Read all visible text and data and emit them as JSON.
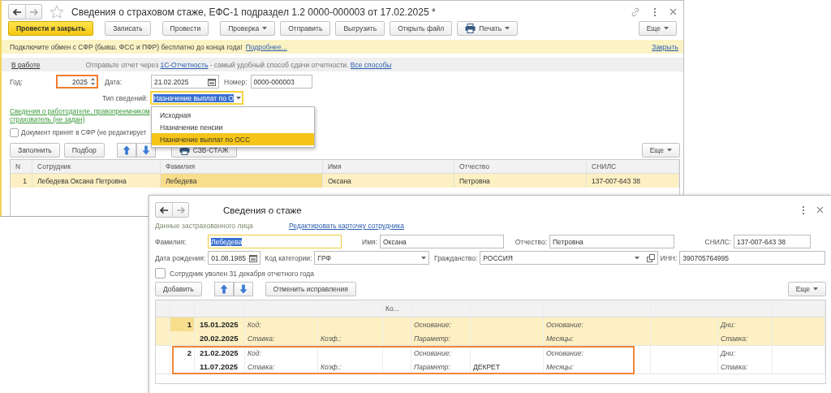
{
  "main_window": {
    "title": "Сведения о страховом стаже, ЕФС-1 подраздел 1.2 0000-000003 от 17.02.2025 *",
    "toolbar": [
      {
        "label": "Провести и закрыть",
        "kind": "primary"
      },
      {
        "label": "Записать",
        "kind": "plain"
      },
      {
        "label": "Провести",
        "kind": "plain"
      },
      {
        "label": "Проверка",
        "kind": "menu"
      },
      {
        "label": "Отправить",
        "kind": "plain"
      },
      {
        "label": "Выгрузить",
        "kind": "plain"
      },
      {
        "label": "Открыть файл",
        "kind": "plain"
      },
      {
        "label": "Печать",
        "kind": "print"
      }
    ],
    "more_button": "Еще",
    "notice": {
      "text": "Подключите обмен с СФР (бывш. ФСС и ПФР) бесплатно до конца года!",
      "link": "Подробнее...",
      "close": "Закрыть"
    },
    "status_bar": {
      "status": "В работе",
      "text_before": "Отправьте отчет через",
      "link": "1С-Отчетность",
      "text_after": "- самый удобный способ сдачи отчетности.",
      "link_2": "Все способы"
    },
    "year": {
      "label": "Год:",
      "value": "2025",
      "highlighted": true
    },
    "date": {
      "label": "Дата:",
      "value": "21.02.2025"
    },
    "number": {
      "label": "Номер:",
      "value": "0000-000003"
    },
    "info_type": {
      "label": "Тип сведений:",
      "value": "Назначение выплат по О",
      "expanded": true
    },
    "info_type_options": [
      {
        "label": "Исходная",
        "selected": false
      },
      {
        "label": "Назначение пенсии",
        "selected": false
      },
      {
        "label": "Назначение выплат по ОСС",
        "selected": true
      }
    ],
    "employer_link": [
      "Сведения о работодателе, правопреемником",
      "страхователь (не задан)"
    ],
    "accepted_checkbox": {
      "label": "Документ принят в СФР (не редактирует",
      "checked": false
    },
    "table_buttons": [
      "Заполнить",
      "Подбор"
    ],
    "report_button": "СЗВ-СТАЖ",
    "table_more": "Еще",
    "table": {
      "columns": [
        "N",
        "Сотрудник",
        "Фамилия",
        "Имя",
        "Отчество",
        "СНИЛС"
      ],
      "rows": [
        {
          "selected": true,
          "cells": [
            "1",
            "Лебедева Оксана Петровна",
            "Лебедева",
            "Оксана",
            "Петровна",
            "137-007-643 38"
          ]
        }
      ]
    }
  },
  "record_window": {
    "title": "Сведения о стаже",
    "section_label": "Данные застрахованного лица",
    "edit_link": "Редактировать карточку сотрудника",
    "fields_row_1": [
      {
        "label": "Фамилия:",
        "value": "Лебедева",
        "kind": "text",
        "focused": true
      },
      {
        "label": "Имя:",
        "value": "Оксана",
        "kind": "text",
        "focused": false
      },
      {
        "label": "Отчество:",
        "value": "Петровна",
        "kind": "text",
        "focused": false
      },
      {
        "label": "СНИЛС:",
        "value": "137-007-643 38",
        "kind": "text",
        "focused": false
      }
    ],
    "fields_row_2": [
      {
        "label": "Дата рождения:",
        "value": "01.08.1985",
        "kind": "date",
        "focused": false
      },
      {
        "label": "Код категории:",
        "value": "ГРФ",
        "kind": "select",
        "focused": false
      },
      {
        "label": "Гражданство:",
        "value": "РОССИЯ",
        "kind": "reference",
        "focused": false
      },
      {
        "label": "ИНН:",
        "value": "390705764995",
        "kind": "text",
        "focused": false
      }
    ],
    "dismissed_checkbox": {
      "label": "Сотрудник уволен 31 декабря отчетного года",
      "checked": false
    },
    "add_button": "Добавить",
    "undo_button": "Отменить исправления",
    "more_button": "Еще",
    "table": {
      "column_header": "Ко...",
      "rows": [
        {
          "n": "1",
          "selected": true,
          "annotated": false,
          "start_date": "15.01.2025",
          "end_date": "20.02.2025",
          "code_label": "Код:",
          "rate_label": "Ставка:",
          "coef_label": "Коэф.:",
          "basis_label": "Основание:",
          "parameter_label": "Параметр:",
          "basis_label_2": "Основание:",
          "months_label": "Месяцы:",
          "days_label": "Дни:",
          "rate_label_2": "Ставка:"
        },
        {
          "n": "2",
          "selected": false,
          "annotated": true,
          "start_date": "21.02.2025",
          "end_date": "11.07.2025",
          "code_label": "Код:",
          "rate_label": "Ставка:",
          "coef_label": "Коэф.:",
          "basis_label": "Основание:",
          "parameter_label": "Параметр:",
          "parameter_value": "ДЕКРЕТ",
          "basis_label_2": "Основание:",
          "months_label": "Месяцы:",
          "days_label": "Дни:",
          "rate_label_2": "Ставка:"
        }
      ]
    }
  }
}
